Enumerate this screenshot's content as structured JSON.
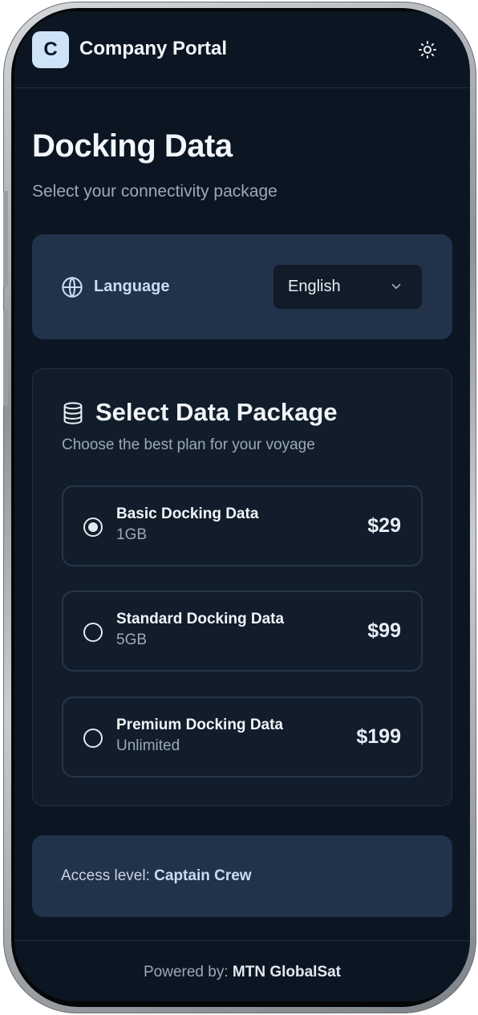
{
  "header": {
    "logo_letter": "C",
    "app_title": "Company Portal",
    "theme_toggle_icon": "sun-icon"
  },
  "page": {
    "title": "Docking Data",
    "subtitle": "Select your connectivity package"
  },
  "language": {
    "icon": "globe-icon",
    "label": "Language",
    "selected": "English"
  },
  "packages": {
    "icon": "database-icon",
    "title": "Select Data Package",
    "subtitle": "Choose the best plan for your voyage",
    "options": [
      {
        "name": "Basic Docking Data",
        "size": "1GB",
        "price": "$29",
        "selected": true
      },
      {
        "name": "Standard Docking Data",
        "size": "5GB",
        "price": "$99",
        "selected": false
      },
      {
        "name": "Premium Docking Data",
        "size": "Unlimited",
        "price": "$199",
        "selected": false
      }
    ]
  },
  "access": {
    "label": "Access level:",
    "value": "Captain Crew"
  },
  "footer": {
    "label": "Powered by:",
    "value": "MTN GlobalSat"
  },
  "colors": {
    "background": "#0c1622",
    "card": "#21324a",
    "accent_text": "#c8dcf2",
    "logo_bg": "#cfe3f8"
  }
}
